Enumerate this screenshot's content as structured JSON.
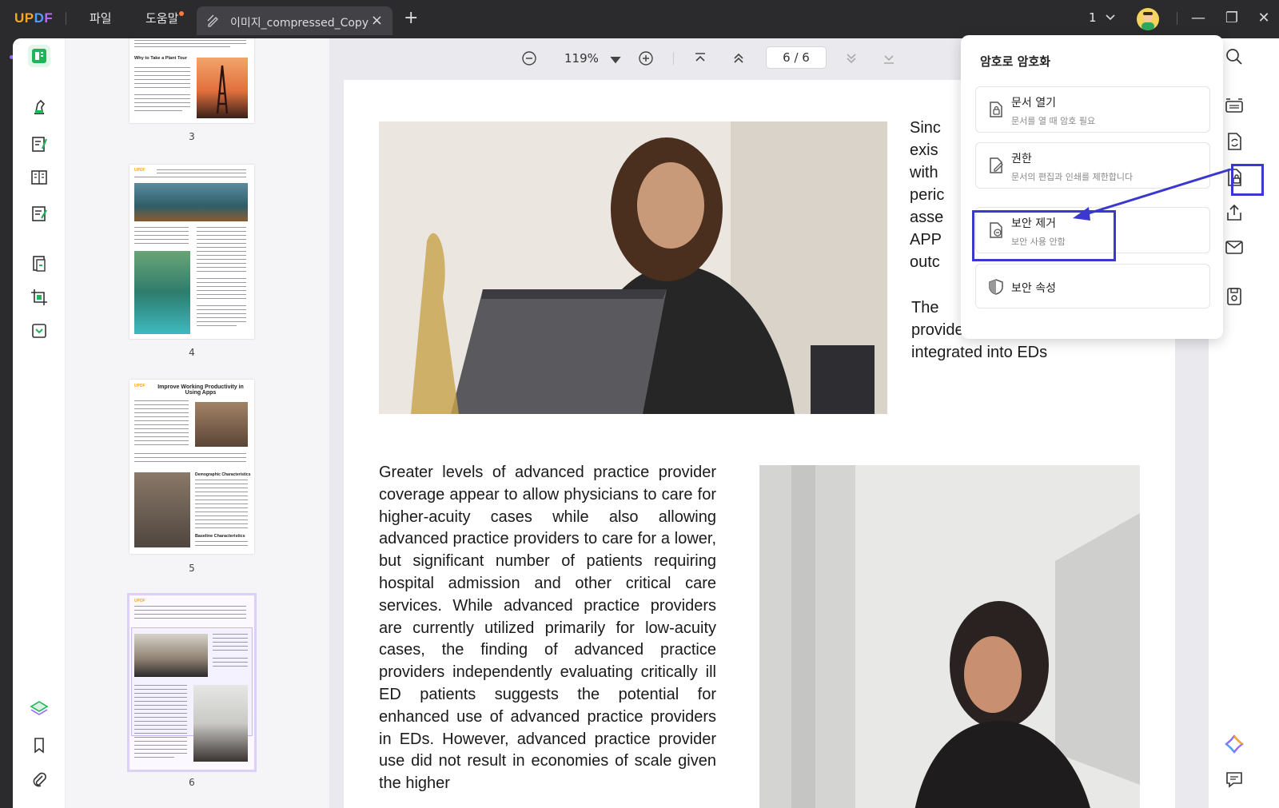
{
  "app": {
    "logo": "UPDF",
    "menu_file": "파일",
    "menu_help": "도움말",
    "tab_title": "이미지_compressed_Copy",
    "tab_close": "×",
    "tab_add": "+",
    "page_select": "1",
    "window_minimize": "—",
    "window_restore": "❐",
    "window_close": "✕"
  },
  "zoom_bar": {
    "zoom_value": "119%",
    "page_indicator": "6 / 6"
  },
  "thumbnails": {
    "pages": [
      {
        "number": "3",
        "heading": "Why to Take a Plant Tour"
      },
      {
        "number": "4",
        "heading": ""
      },
      {
        "number": "5",
        "heading": "Improve Working Productivity in Using Apps",
        "sub1": "Demographic Characteristics",
        "sub2": "Baseline Characteristics"
      },
      {
        "number": "6",
        "heading": ""
      }
    ]
  },
  "document": {
    "right_para1_lines": [
      "Sinc",
      "exis",
      "with",
      "peric",
      "asse",
      "APP",
      "outc"
    ],
    "right_para2": "The advanced practice providers can be effectively integrated into EDs",
    "right_para2_line1": "The",
    "left_para": "Greater levels of advanced practice provider coverage appear to allow physicians to care for higher-acuity cases while also allowing advanced practice providers to care for a lower, but significant number of patients requiring hospital admission and other critical care services. While advanced practice providers are currently utilized primarily for low-acuity cases, the finding of advanced practice providers independently evaluating critically ill ED patients suggests the potential for enhanced use of advanced practice providers in EDs. However, advanced practice provider use did not result in economies of scale given the higher"
  },
  "security_popup": {
    "title": "암호로 암호화",
    "options": [
      {
        "label": "문서 열기",
        "sub": "문서를 열 때 암호 필요"
      },
      {
        "label": "권한",
        "sub": "문서의 편집과 인쇄를 제한합니다"
      },
      {
        "label": "보안 제거",
        "sub": "보안 사용 안함"
      },
      {
        "label": "보안 속성",
        "sub": ""
      }
    ]
  },
  "colors": {
    "accent": "#3b38d0",
    "brand_green": "#1fb35a",
    "titlebar": "#2b2b2e"
  }
}
